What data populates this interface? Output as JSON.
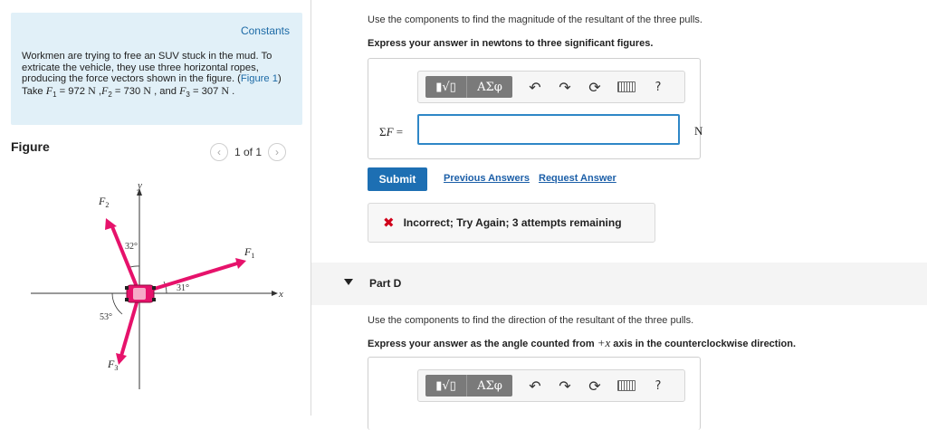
{
  "left_panel": {
    "constants_link": "Constants",
    "problem": {
      "intro": "Workmen are trying to free an SUV stuck in the mud. To extricate the vehicle, they use three horizontal ropes, producing the force vectors shown in the figure. (",
      "figure_link": "Figure 1",
      "take": ") Take ",
      "f1_sym": "F",
      "f1_sub": "1",
      "f1_val": " = 972 ",
      "f1_unit": "N",
      "sep1": " ,",
      "f2_sym": "F",
      "f2_sub": "2",
      "f2_val": " = 730 ",
      "f2_unit": "N",
      "sep2": " , and ",
      "f3_sym": "F",
      "f3_sub": "3",
      "f3_val": " = 307 ",
      "f3_unit": "N",
      "end": " ."
    },
    "figure": {
      "title": "Figure",
      "pager_prev_icon": "chevron-left-icon",
      "pager_text": "1 of 1",
      "pager_next_icon": "chevron-right-icon",
      "labels": {
        "y_axis": "y",
        "x_axis": "x",
        "f1": "F",
        "f1_sub": "1",
        "f2": "F",
        "f2_sub": "2",
        "f3": "F",
        "f3_sub": "3",
        "angle_f2": "32°",
        "angle_f1": "31°",
        "angle_f3": "53°"
      },
      "colors": {
        "vector": "#e6126b",
        "car": "#e6126b",
        "axis": "#333333"
      }
    }
  },
  "right_panel": {
    "part_c": {
      "instruction": "Use the components to find the magnitude of the resultant of the three pulls.",
      "format_hint": "Express your answer in newtons to three significant figures.",
      "toolbar": {
        "math_button": "▮√▯",
        "greek_button": "ΑΣφ",
        "undo_icon": "↶",
        "redo_icon": "↷",
        "reset_icon": "⟳",
        "keyboard_icon": "keyboard-icon",
        "help_icon": "?"
      },
      "equation_label_prefix": "Σ",
      "equation_label_var": "F",
      "equation_label_suffix": " =",
      "input_value": "",
      "unit": "N",
      "submit_label": "Submit",
      "previous_answers_link": "Previous Answers",
      "request_answer_link": "Request Answer",
      "feedback_icon": "✖",
      "feedback_text": "Incorrect; Try Again; 3 attempts remaining"
    },
    "part_d": {
      "title": "Part D",
      "instruction": "Use the components to find the direction of the resultant of the three pulls.",
      "format_hint_before": "Express your answer as the angle counted from ",
      "format_hint_math": "+x",
      "format_hint_after": " axis in the counterclockwise direction.",
      "toolbar": {
        "math_button": "▮√▯",
        "greek_button": "ΑΣφ",
        "undo_icon": "↶",
        "redo_icon": "↷",
        "reset_icon": "⟳",
        "keyboard_icon": "keyboard-icon",
        "help_icon": "?"
      }
    },
    "colors": {
      "submit_bg": "#1d6fb3",
      "link": "#1c5fa8",
      "error": "#d0021b",
      "input_border": "#2f87c7"
    }
  }
}
